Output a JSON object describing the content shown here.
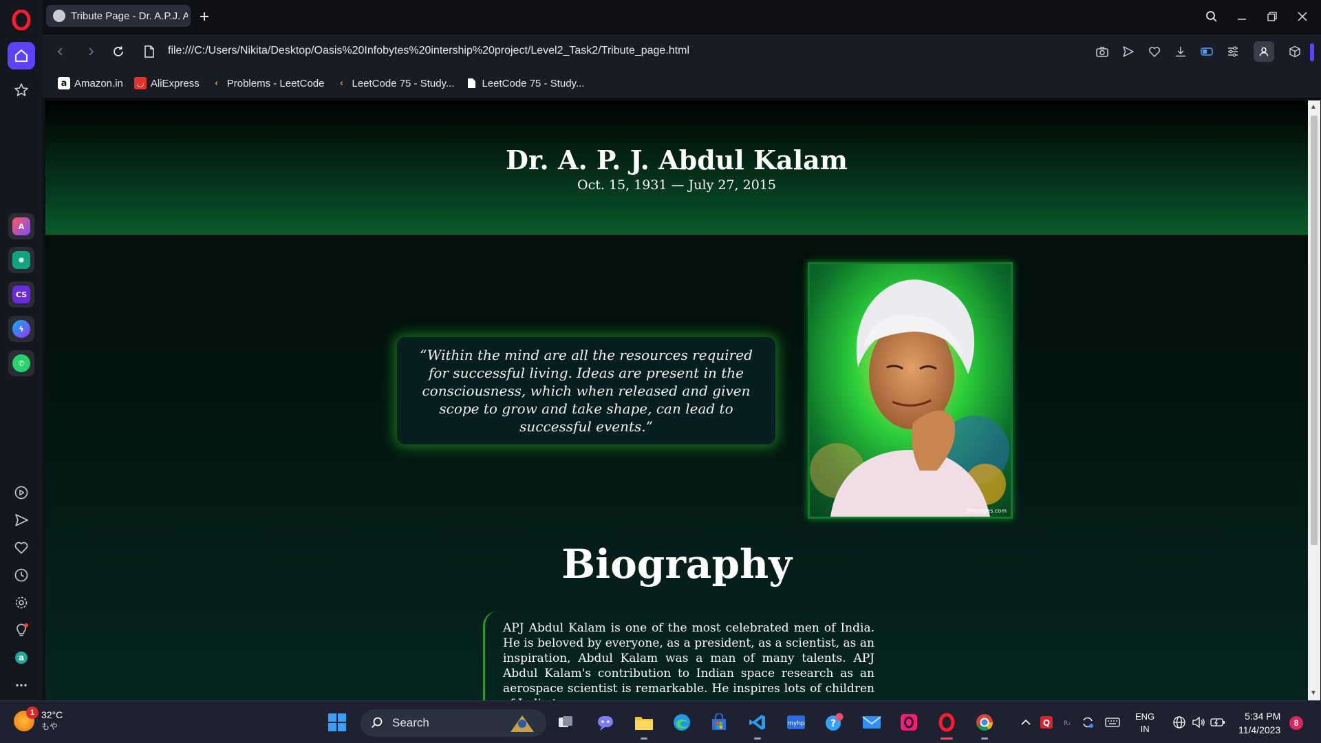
{
  "browser": {
    "tab_title": "Tribute Page - Dr. A.P.J. Al",
    "url": "file:///C:/Users/Nikita/Desktop/Oasis%20Infobytes%20intership%20project/Level2_Task2/Tribute_page.html",
    "bookmarks": [
      {
        "label": "Amazon.in",
        "icon": "amazon-icon",
        "color": "#ffffff"
      },
      {
        "label": "AliExpress",
        "icon": "aliexpress-icon",
        "color": "#e43225"
      },
      {
        "label": "Problems - LeetCode",
        "icon": "leetcode-icon",
        "color": "#f89f1b"
      },
      {
        "label": "LeetCode 75 - Study...",
        "icon": "leetcode-icon",
        "color": "#f89f1b"
      },
      {
        "label": "LeetCode 75 - Study...",
        "icon": "page-icon",
        "color": "#ffffff"
      }
    ],
    "accent_color": "#5b43ff"
  },
  "page": {
    "name": "Dr. A. P. J. Abdul Kalam",
    "dates": "Oct. 15, 1931 — July 27, 2015",
    "quote": "“Within the mind are all the resources required for successful living. Ideas are present in the consciousness, which when released and given scope to grow and take shape, can lead to successful events.”",
    "portrait_caption": "99images.com",
    "bio_heading": "Biography",
    "bio_text": "APJ Abdul Kalam is one of the most celebrated men of India. He is beloved by everyone, as a president, as a scientist, as an inspiration, Abdul Kalam was a man of many talents. APJ Abdul Kalam's contribution to Indian space research as an aerospace scientist is remarkable. He inspires lots of children of India to",
    "theme_green": "#0a5a2b"
  },
  "taskbar": {
    "weather_temp": "32°C",
    "weather_desc": "もや",
    "weather_badge": "1",
    "search_placeholder": "Search",
    "lang_top": "ENG",
    "lang_bottom": "IN",
    "time": "5:34 PM",
    "date": "11/4/2023",
    "notification_count": "8"
  }
}
